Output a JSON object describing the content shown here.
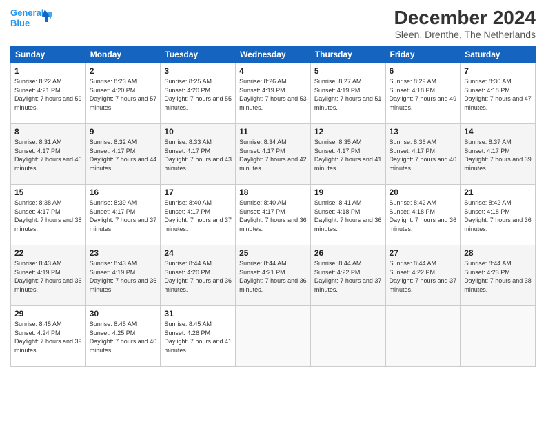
{
  "logo": {
    "line1": "General",
    "line2": "Blue"
  },
  "title": "December 2024",
  "location": "Sleen, Drenthe, The Netherlands",
  "weekdays": [
    "Sunday",
    "Monday",
    "Tuesday",
    "Wednesday",
    "Thursday",
    "Friday",
    "Saturday"
  ],
  "weeks": [
    [
      {
        "day": "1",
        "sunrise": "8:22 AM",
        "sunset": "4:21 PM",
        "daylight": "7 hours and 59 minutes."
      },
      {
        "day": "2",
        "sunrise": "8:23 AM",
        "sunset": "4:20 PM",
        "daylight": "7 hours and 57 minutes."
      },
      {
        "day": "3",
        "sunrise": "8:25 AM",
        "sunset": "4:20 PM",
        "daylight": "7 hours and 55 minutes."
      },
      {
        "day": "4",
        "sunrise": "8:26 AM",
        "sunset": "4:19 PM",
        "daylight": "7 hours and 53 minutes."
      },
      {
        "day": "5",
        "sunrise": "8:27 AM",
        "sunset": "4:19 PM",
        "daylight": "7 hours and 51 minutes."
      },
      {
        "day": "6",
        "sunrise": "8:29 AM",
        "sunset": "4:18 PM",
        "daylight": "7 hours and 49 minutes."
      },
      {
        "day": "7",
        "sunrise": "8:30 AM",
        "sunset": "4:18 PM",
        "daylight": "7 hours and 47 minutes."
      }
    ],
    [
      {
        "day": "8",
        "sunrise": "8:31 AM",
        "sunset": "4:17 PM",
        "daylight": "7 hours and 46 minutes."
      },
      {
        "day": "9",
        "sunrise": "8:32 AM",
        "sunset": "4:17 PM",
        "daylight": "7 hours and 44 minutes."
      },
      {
        "day": "10",
        "sunrise": "8:33 AM",
        "sunset": "4:17 PM",
        "daylight": "7 hours and 43 minutes."
      },
      {
        "day": "11",
        "sunrise": "8:34 AM",
        "sunset": "4:17 PM",
        "daylight": "7 hours and 42 minutes."
      },
      {
        "day": "12",
        "sunrise": "8:35 AM",
        "sunset": "4:17 PM",
        "daylight": "7 hours and 41 minutes."
      },
      {
        "day": "13",
        "sunrise": "8:36 AM",
        "sunset": "4:17 PM",
        "daylight": "7 hours and 40 minutes."
      },
      {
        "day": "14",
        "sunrise": "8:37 AM",
        "sunset": "4:17 PM",
        "daylight": "7 hours and 39 minutes."
      }
    ],
    [
      {
        "day": "15",
        "sunrise": "8:38 AM",
        "sunset": "4:17 PM",
        "daylight": "7 hours and 38 minutes."
      },
      {
        "day": "16",
        "sunrise": "8:39 AM",
        "sunset": "4:17 PM",
        "daylight": "7 hours and 37 minutes."
      },
      {
        "day": "17",
        "sunrise": "8:40 AM",
        "sunset": "4:17 PM",
        "daylight": "7 hours and 37 minutes."
      },
      {
        "day": "18",
        "sunrise": "8:40 AM",
        "sunset": "4:17 PM",
        "daylight": "7 hours and 36 minutes."
      },
      {
        "day": "19",
        "sunrise": "8:41 AM",
        "sunset": "4:18 PM",
        "daylight": "7 hours and 36 minutes."
      },
      {
        "day": "20",
        "sunrise": "8:42 AM",
        "sunset": "4:18 PM",
        "daylight": "7 hours and 36 minutes."
      },
      {
        "day": "21",
        "sunrise": "8:42 AM",
        "sunset": "4:18 PM",
        "daylight": "7 hours and 36 minutes."
      }
    ],
    [
      {
        "day": "22",
        "sunrise": "8:43 AM",
        "sunset": "4:19 PM",
        "daylight": "7 hours and 36 minutes."
      },
      {
        "day": "23",
        "sunrise": "8:43 AM",
        "sunset": "4:19 PM",
        "daylight": "7 hours and 36 minutes."
      },
      {
        "day": "24",
        "sunrise": "8:44 AM",
        "sunset": "4:20 PM",
        "daylight": "7 hours and 36 minutes."
      },
      {
        "day": "25",
        "sunrise": "8:44 AM",
        "sunset": "4:21 PM",
        "daylight": "7 hours and 36 minutes."
      },
      {
        "day": "26",
        "sunrise": "8:44 AM",
        "sunset": "4:22 PM",
        "daylight": "7 hours and 37 minutes."
      },
      {
        "day": "27",
        "sunrise": "8:44 AM",
        "sunset": "4:22 PM",
        "daylight": "7 hours and 37 minutes."
      },
      {
        "day": "28",
        "sunrise": "8:44 AM",
        "sunset": "4:23 PM",
        "daylight": "7 hours and 38 minutes."
      }
    ],
    [
      {
        "day": "29",
        "sunrise": "8:45 AM",
        "sunset": "4:24 PM",
        "daylight": "7 hours and 39 minutes."
      },
      {
        "day": "30",
        "sunrise": "8:45 AM",
        "sunset": "4:25 PM",
        "daylight": "7 hours and 40 minutes."
      },
      {
        "day": "31",
        "sunrise": "8:45 AM",
        "sunset": "4:26 PM",
        "daylight": "7 hours and 41 minutes."
      },
      null,
      null,
      null,
      null
    ]
  ]
}
